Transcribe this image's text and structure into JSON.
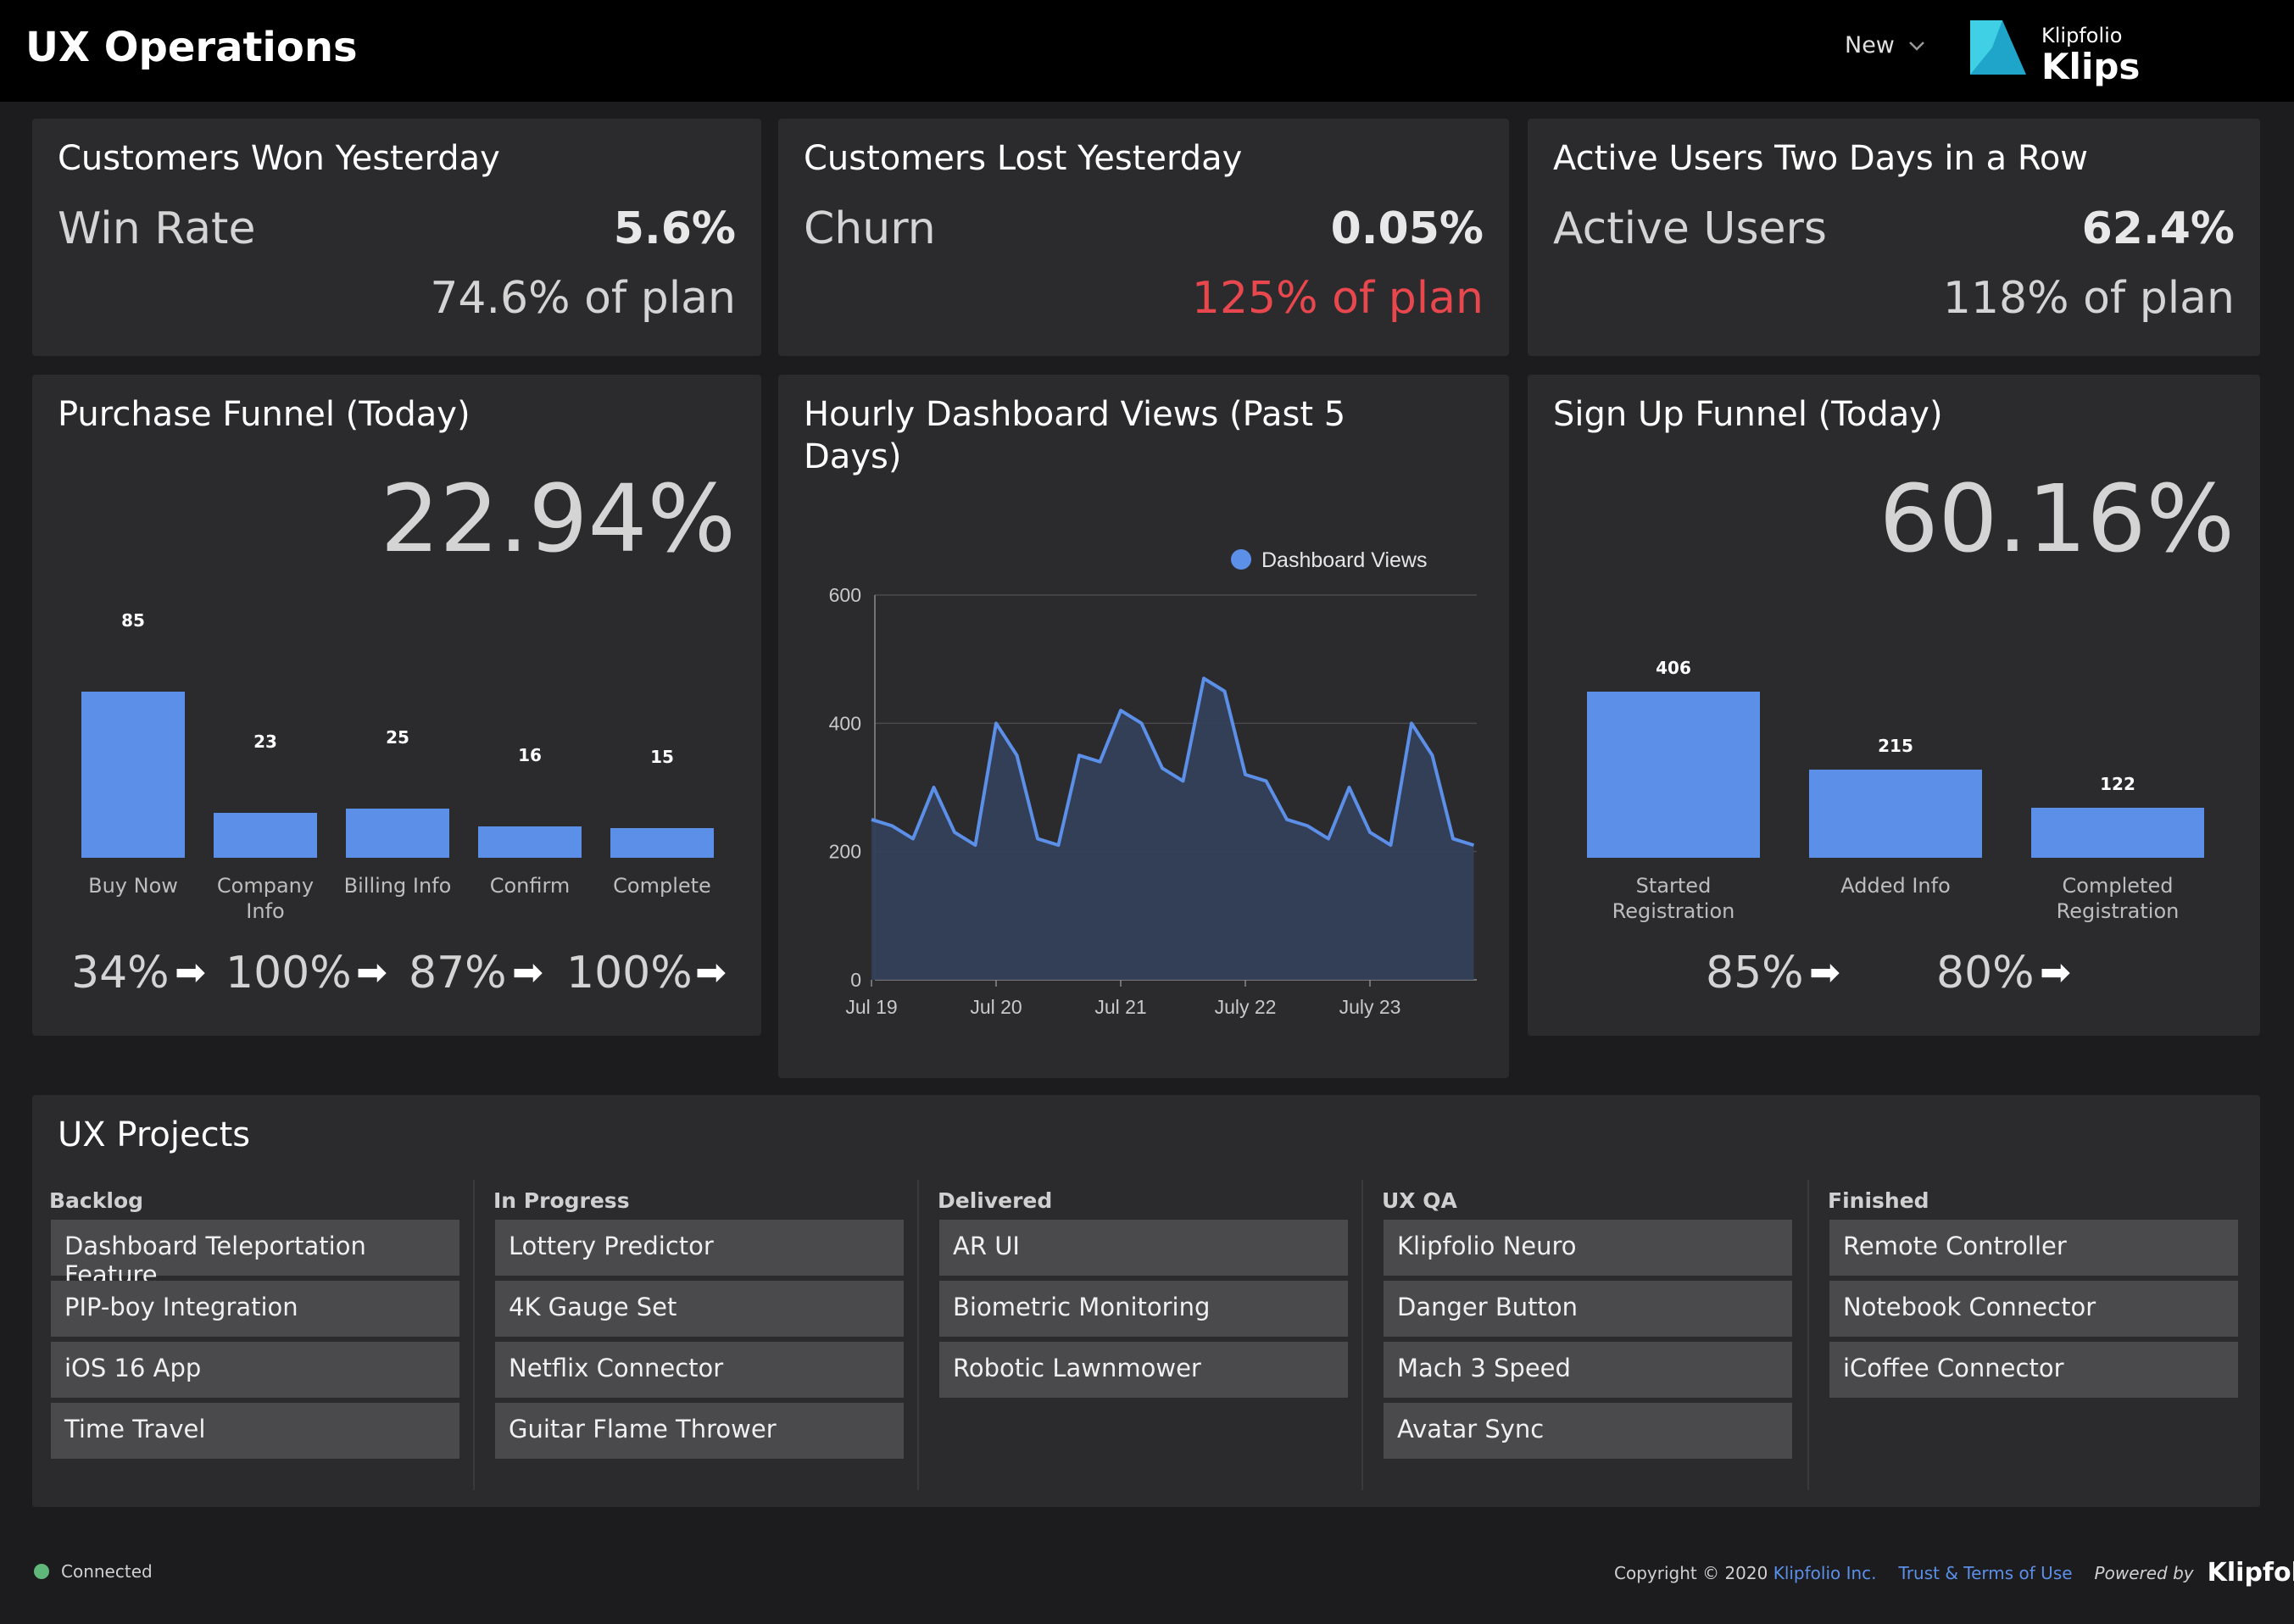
{
  "header": {
    "title": "UX Operations",
    "new_label": "New",
    "logo_small": "Klipfolio",
    "logo_big": "Klips"
  },
  "kpis": [
    {
      "title": "Customers Won Yesterday",
      "label": "Win Rate",
      "value": "5.6%",
      "plan": "74.6% of plan"
    },
    {
      "title": "Customers Lost Yesterday",
      "label": "Churn",
      "value": "0.05%",
      "plan": "125% of plan"
    },
    {
      "title": "Active Users Two Days in a Row",
      "label": "Active Users",
      "value": "62.4%",
      "plan": "118% of plan"
    }
  ],
  "purchase_funnel": {
    "title": "Purchase Funnel (Today)",
    "headline": "22.94%",
    "steps": [
      "34%",
      "100%",
      "87%",
      "100%"
    ]
  },
  "signup_funnel": {
    "title": "Sign Up Funnel (Today)",
    "headline": "60.16%",
    "steps": [
      "85%",
      "80%"
    ]
  },
  "dashboard_views": {
    "title_line1": "Hourly Dashboard Views (Past 5",
    "title_line2": "Days)"
  },
  "chart_data": [
    {
      "type": "bar",
      "categories": [
        "Buy Now",
        "Company Info",
        "Billing Info",
        "Confirm",
        "Complete"
      ],
      "values": [
        85,
        23,
        25,
        16,
        15
      ],
      "ylim": [
        0,
        85
      ]
    },
    {
      "type": "area",
      "legend": "Dashboard Views",
      "legend_position": "top-right",
      "x_ticks": [
        "Jul 19",
        "Jul 20",
        "Jul 21",
        "July 22",
        "July 23"
      ],
      "y_ticks": [
        "0",
        "200",
        "400",
        "600"
      ],
      "ylim": [
        0,
        600
      ],
      "grid": true,
      "series": [
        {
          "name": "Dashboard Views",
          "color": "#5b8fe8",
          "values": [
            250,
            240,
            220,
            300,
            230,
            210,
            400,
            350,
            220,
            210,
            350,
            340,
            420,
            400,
            330,
            310,
            470,
            450,
            320,
            310,
            250,
            240,
            220,
            300,
            230,
            210,
            400,
            350,
            220,
            210
          ]
        }
      ]
    },
    {
      "type": "bar",
      "categories": [
        "Started Registration",
        "Added Info",
        "Completed Registration"
      ],
      "values": [
        406,
        215,
        122
      ],
      "ylim": [
        0,
        406
      ]
    }
  ],
  "projects": {
    "title": "UX Projects",
    "columns": [
      {
        "name": "Backlog",
        "items": [
          "Dashboard Teleportation Feature",
          "PIP-boy Integration",
          "iOS 16 App",
          "Time Travel"
        ]
      },
      {
        "name": "In Progress",
        "items": [
          "Lottery Predictor",
          "4K Gauge Set",
          "Netflix Connector",
          "Guitar Flame Thrower"
        ]
      },
      {
        "name": "Delivered",
        "items": [
          "AR UI",
          "Biometric Monitoring",
          "Robotic Lawnmower"
        ]
      },
      {
        "name": "UX QA",
        "items": [
          "Klipfolio Neuro",
          "Danger Button",
          "Mach 3 Speed",
          "Avatar Sync"
        ]
      },
      {
        "name": "Finished",
        "items": [
          "Remote Controller",
          "Notebook Connector",
          "iCoffee Connector"
        ]
      }
    ]
  },
  "footer": {
    "status": "Connected",
    "copyright": "Copyright © 2020",
    "company_link": "Klipfolio Inc.",
    "terms_link": "Trust & Terms of Use",
    "powered_by": "Powered by",
    "brand": "Klipfolio"
  },
  "colors": {
    "accent": "#5b8fe8",
    "negative": "#e8474e",
    "connected": "#5fb87a"
  }
}
